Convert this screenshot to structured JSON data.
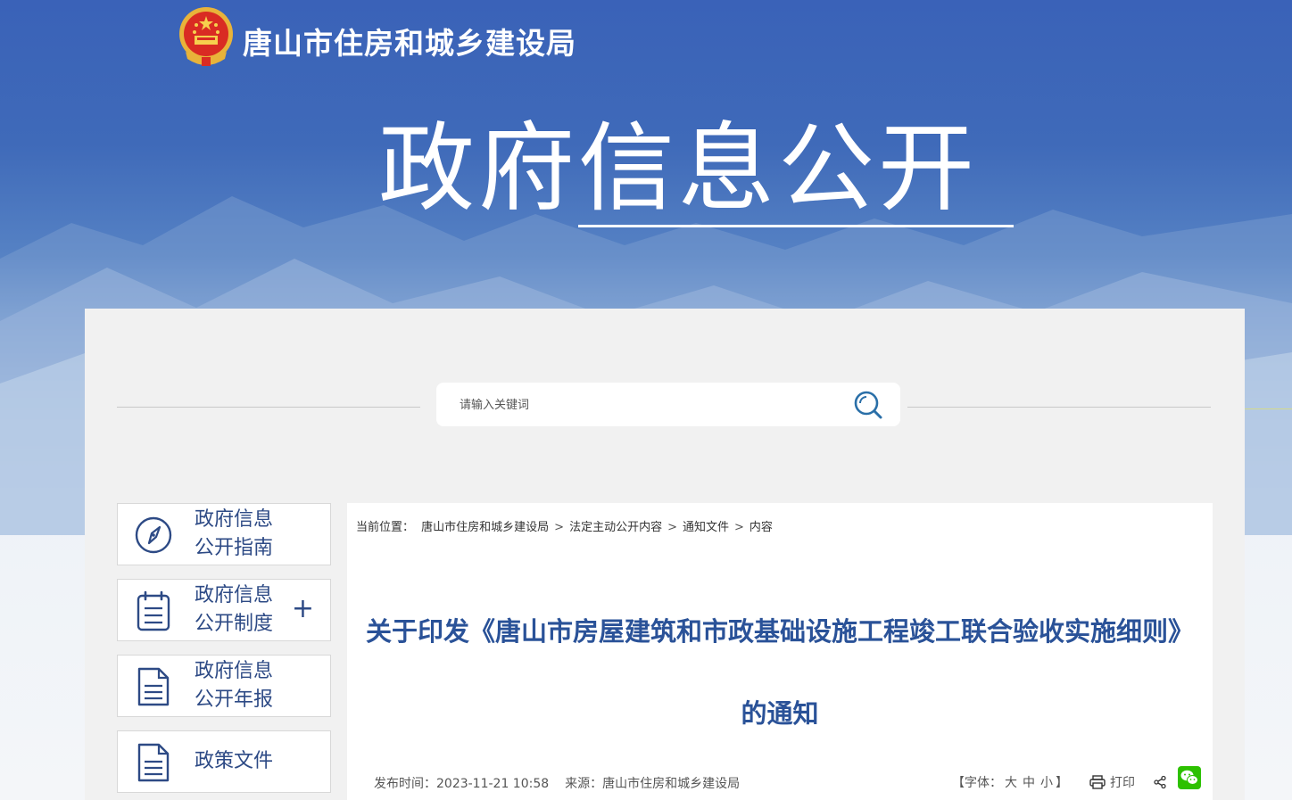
{
  "header": {
    "site_name": "唐山市住房和城乡建设局",
    "hero_title": "政府信息公开"
  },
  "search": {
    "placeholder": "请输入关键词"
  },
  "sidebar": {
    "items": [
      {
        "label": "政府信息\n公开指南",
        "icon": "compass-icon"
      },
      {
        "label": "政府信息\n公开制度",
        "icon": "clipboard-icon",
        "expand": "+"
      },
      {
        "label": "政府信息\n公开年报",
        "icon": "document-icon"
      },
      {
        "label": "政策文件",
        "icon": "document-icon"
      }
    ]
  },
  "breadcrumb": {
    "prefix": "当前位置：",
    "items": [
      "唐山市住房和城乡建设局",
      "法定主动公开内容",
      "通知文件",
      "内容"
    ],
    "separator": ">"
  },
  "article": {
    "title": "关于印发《唐山市房屋建筑和市政基础设施工程竣工联合验收实施细则》的通知",
    "publish_label": "发布时间：",
    "publish_time": "2023-11-21 10:58",
    "source_label": "来源：",
    "source": "唐山市住房和城乡建设局"
  },
  "tools": {
    "font_size_prefix": "【字体：",
    "font_large": "大",
    "font_medium": "中",
    "font_small": "小",
    "font_size_suffix": "】",
    "print_label": "打印"
  },
  "colors": {
    "brand_blue": "#3f6ab9",
    "title_blue": "#2a5298",
    "nav_blue": "#2d4a85",
    "wechat_green": "#2dc100"
  }
}
